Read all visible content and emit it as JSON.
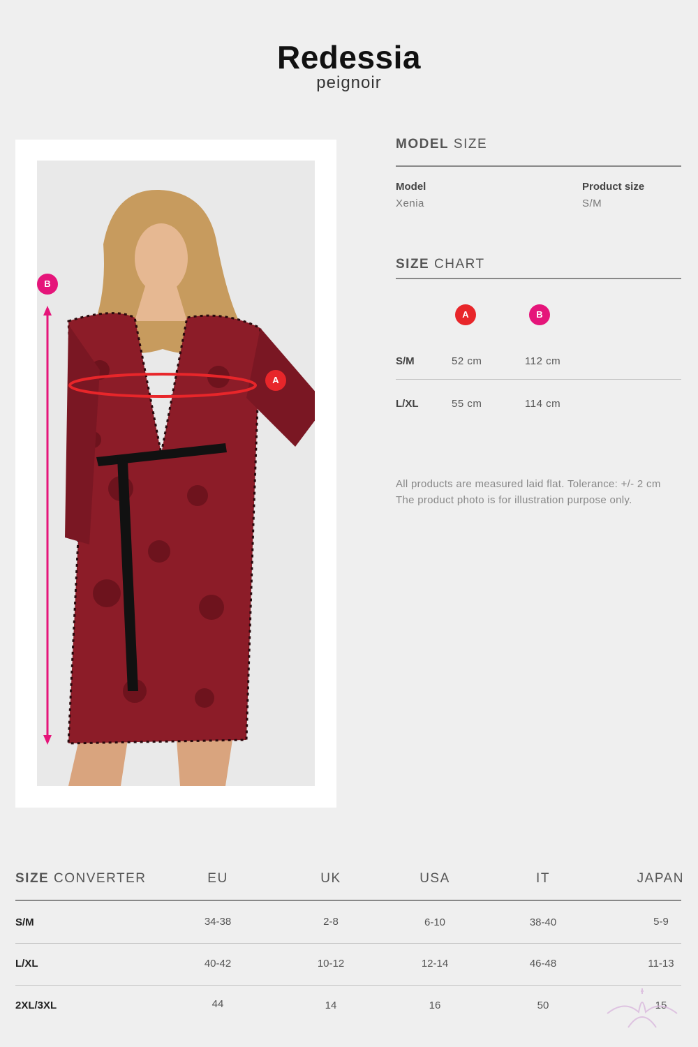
{
  "header": {
    "title": "Redessia",
    "subtitle": "peignoir"
  },
  "photo": {
    "markers": {
      "a": "A",
      "b": "B"
    }
  },
  "model_size": {
    "heading_bold": "MODEL",
    "heading_light": "SIZE",
    "model_label": "Model",
    "model_value": "Xenia",
    "size_label": "Product size",
    "size_value": "S/M"
  },
  "size_chart": {
    "heading_bold": "SIZE",
    "heading_light": "CHART",
    "columns": [
      "A",
      "B"
    ],
    "rows": [
      {
        "size": "S/M",
        "a": "52 cm",
        "b": "112 cm"
      },
      {
        "size": "L/XL",
        "a": "55 cm",
        "b": "114 cm"
      }
    ],
    "note_line1": "All products are measured laid flat. Tolerance: +/- 2 cm",
    "note_line2": "The product photo is for illustration purpose only."
  },
  "size_converter": {
    "heading_bold": "SIZE",
    "heading_light": "CONVERTER",
    "columns": [
      "EU",
      "UK",
      "USA",
      "IT",
      "JAPAN"
    ],
    "rows": [
      {
        "size": "S/M",
        "values": [
          "34-38",
          "2-8",
          "6-10",
          "38-40",
          "5-9"
        ]
      },
      {
        "size": "L/XL",
        "values": [
          "40-42",
          "10-12",
          "12-14",
          "46-48",
          "11-13"
        ]
      },
      {
        "size": "2XL/3XL",
        "values": [
          "44",
          "14",
          "16",
          "50",
          "15"
        ]
      }
    ]
  },
  "colors": {
    "marker_a": "#e8262a",
    "marker_b": "#e5157a",
    "garment": "#8c1c28"
  }
}
